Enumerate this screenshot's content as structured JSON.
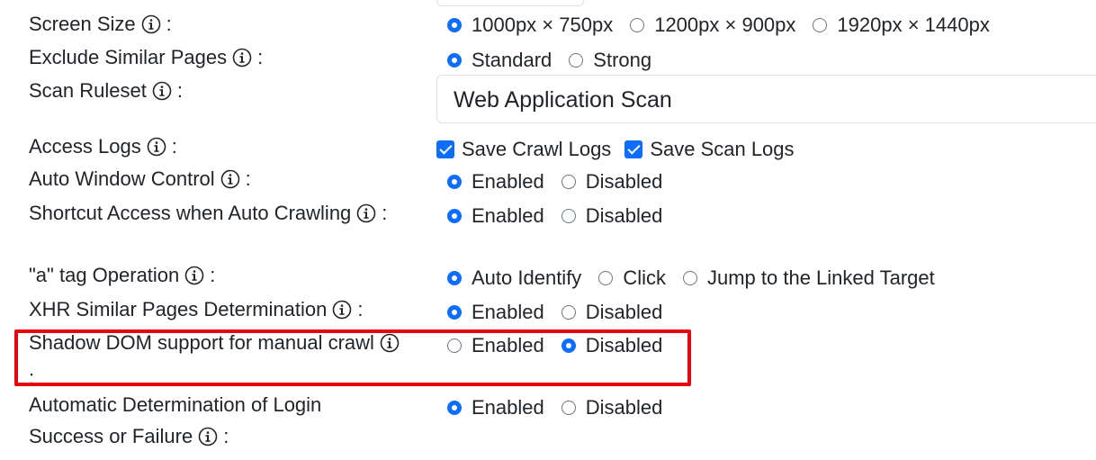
{
  "colon": ":",
  "settings": {
    "screen_size": {
      "label": "Screen Size",
      "options": [
        "1000px × 750px",
        "1200px × 900px",
        "1920px × 1440px"
      ],
      "selected": "1000px × 750px"
    },
    "exclude_similar": {
      "label": "Exclude Similar Pages",
      "options": [
        "Standard",
        "Strong"
      ],
      "selected": "Standard"
    },
    "scan_ruleset": {
      "label": "Scan Ruleset",
      "value": "Web Application Scan"
    },
    "access_logs": {
      "label": "Access Logs",
      "options": [
        "Save Crawl Logs",
        "Save Scan Logs"
      ],
      "checked": [
        true,
        true
      ]
    },
    "auto_window": {
      "label": "Auto Window Control",
      "options": [
        "Enabled",
        "Disabled"
      ],
      "selected": "Enabled"
    },
    "shortcut_access": {
      "label": "Shortcut Access when Auto Crawling",
      "options": [
        "Enabled",
        "Disabled"
      ],
      "selected": "Enabled"
    },
    "a_tag": {
      "label": "\"a\" tag Operation",
      "options": [
        "Auto Identify",
        "Click",
        "Jump to the Linked Target"
      ],
      "selected": "Auto Identify"
    },
    "xhr_similar": {
      "label": "XHR Similar Pages Determination",
      "options": [
        "Enabled",
        "Disabled"
      ],
      "selected": "Enabled"
    },
    "shadow_dom": {
      "label": "Shadow DOM support for manual crawl",
      "options": [
        "Enabled",
        "Disabled"
      ],
      "selected": "Disabled"
    },
    "auto_login": {
      "label": "Automatic Determination of Login Success or Failure",
      "options": [
        "Enabled",
        "Disabled"
      ],
      "selected": "Enabled"
    }
  },
  "colors": {
    "accent": "#0d6efd",
    "highlight": "#e8050c"
  },
  "icons": {
    "info": "info-circle-icon"
  }
}
